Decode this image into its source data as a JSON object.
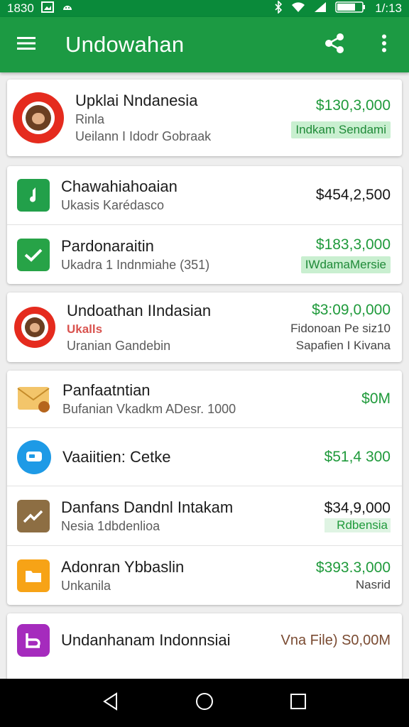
{
  "status_bar": {
    "time_left": "1830",
    "time_right": "1/:13",
    "battery": "67%"
  },
  "app_bar": {
    "title": "Undowahan",
    "icons": [
      "menu-icon",
      "share-icon",
      "more-vert-icon"
    ]
  },
  "items": {
    "card1": {
      "title": "Upklai Nndanesia",
      "line2": "Rinla",
      "line3": "Ueilann I Idodr Gobraak",
      "amount": "$130,3,000",
      "tag": "Indkam Sendami"
    },
    "card2_row1": {
      "title": "Chawahiahoaian",
      "sub": "Ukasis Karédasco",
      "amount": "$454,2,500"
    },
    "card2_row2": {
      "title": "Pardonaraitin",
      "sub": "Ukadra 1 Indnmiahe (351)",
      "amount": "$183,3,000",
      "tag": "IWdamaMersie"
    },
    "card3": {
      "title": "Undoathan IIndasian",
      "line2": "Ukalls",
      "line3": "Uranian Gandebin",
      "amount": "$3:09,0,000",
      "right2": "Fidonoan Pe siz10",
      "right3": "Sapafien I Kivana"
    },
    "card4_row1": {
      "title": "Panfaatntian",
      "sub": "Bufanian Vkadkm ADesr. 1000",
      "amount": "$0M"
    },
    "card4_row2": {
      "title": "Vaaiitien: Cetke",
      "amount": "$51,4 300"
    },
    "card4_row3": {
      "title": "Danfans Dandnl Intakam",
      "sub": "Nesia 1dbdenlioa",
      "amount": "$34,9,000",
      "tag": "Rdbensia"
    },
    "card4_row4": {
      "title": "Adonran Ybbaslin",
      "sub": "Unkanila",
      "amount": "$393.3,000",
      "right2": "Nasrid"
    },
    "card5": {
      "title": "Undanhanam Indonnsiai",
      "amount": "Vna File) S0,00M"
    }
  },
  "colors": {
    "primary": "#1c9a43",
    "status": "#0a8a3a",
    "amount_green": "#1f9a3b",
    "red_icon": "#e52b1e"
  }
}
